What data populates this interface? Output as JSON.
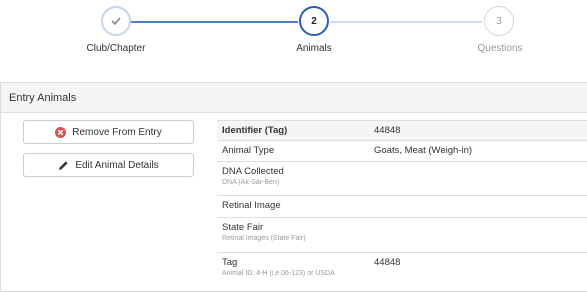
{
  "stepper": {
    "steps": [
      {
        "number": "",
        "label": "Club/Chapter",
        "state": "complete"
      },
      {
        "number": "2",
        "label": "Animals",
        "state": "active"
      },
      {
        "number": "3",
        "label": "Questions",
        "state": "pending"
      }
    ]
  },
  "panel": {
    "title": "Entry Animals",
    "buttons": {
      "remove_label": "Remove From Entry",
      "edit_label": "Edit Animal Details"
    }
  },
  "details": {
    "rows": [
      {
        "label": "Identifier (Tag)",
        "sublabel": "",
        "value": "44848"
      },
      {
        "label": "Animal Type",
        "sublabel": "",
        "value": "Goats, Meat (Weigh-in)"
      },
      {
        "label": "DNA Collected",
        "sublabel": "DNA (Ak-Sar-Ben)",
        "value": ""
      },
      {
        "label": "Retinal Image",
        "sublabel": "",
        "value": ""
      },
      {
        "label": "State Fair",
        "sublabel": "Retinal Images (State Fair)",
        "value": ""
      },
      {
        "label": "Tag",
        "sublabel": "Animal ID: 4-H (i.e.06-123) or USDA",
        "value": "44848"
      }
    ]
  },
  "colors": {
    "accent": "#2f5fb0",
    "remove_icon": "#d9534f"
  },
  "icons": {
    "step1": "check-icon",
    "remove": "remove-circle-icon",
    "edit": "pencil-icon"
  }
}
